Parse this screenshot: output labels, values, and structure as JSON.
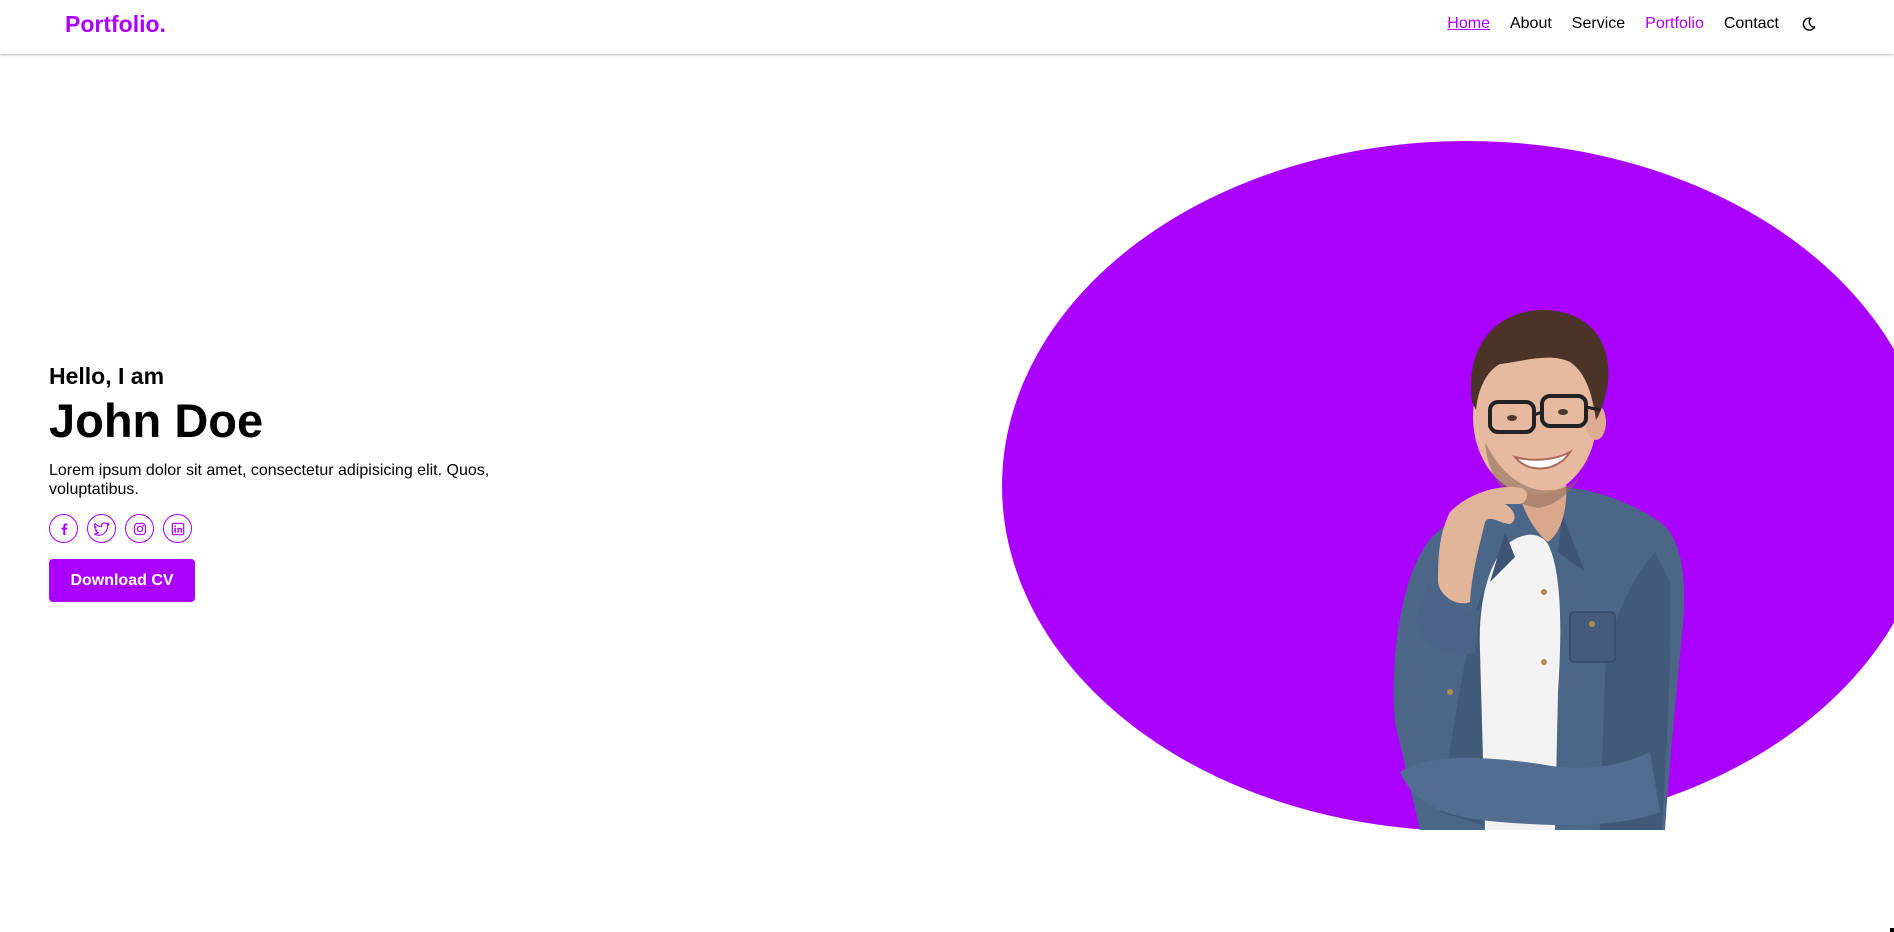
{
  "navbar": {
    "logo": "Portfolio.",
    "links": [
      "Home",
      "About",
      "Service",
      "Portfolio",
      "Contact"
    ],
    "theme_toggle_icon": "moon-icon"
  },
  "hero": {
    "greeting": "Hello, I am",
    "name": "John Doe",
    "description": "Lorem ipsum dolor sit amet, consectetur adipisicing elit. Quos, voluptatibus.",
    "social_icons": [
      "facebook-icon",
      "twitter-icon",
      "instagram-icon",
      "linkedin-icon"
    ],
    "cta_label": "Download CV"
  },
  "colors": {
    "accent": "#aa00ff",
    "text": "#000000",
    "background": "#ffffff",
    "shirt": "#4c6688",
    "skin": "#e6b9a0",
    "hair": "#4a3327"
  }
}
